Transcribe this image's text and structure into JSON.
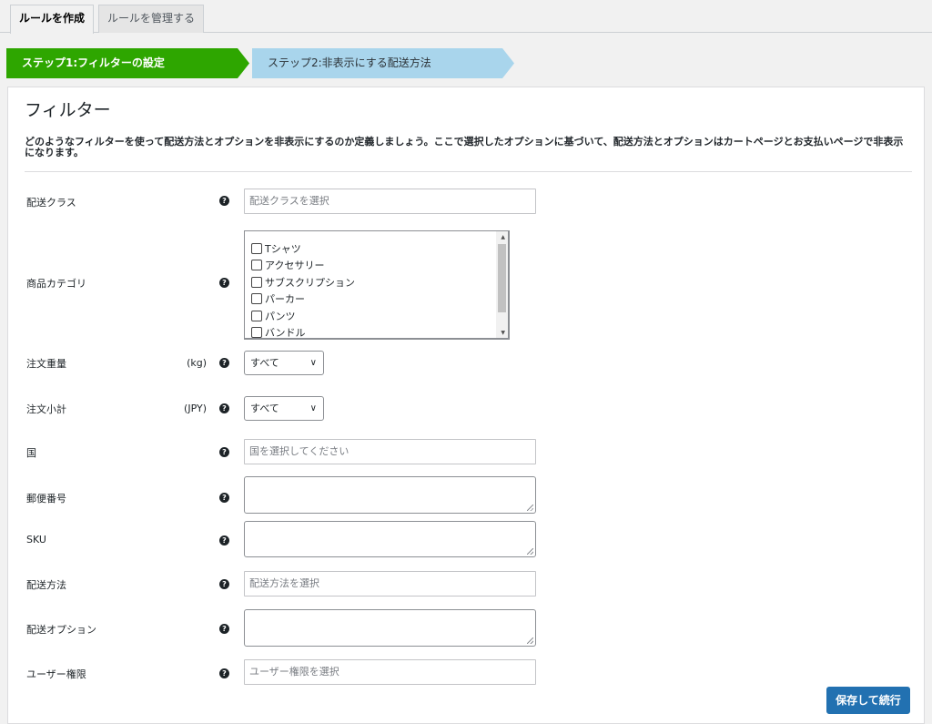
{
  "tabs": [
    {
      "label": "ルールを作成",
      "active": true
    },
    {
      "label": "ルールを管理する",
      "active": false
    }
  ],
  "steps": [
    {
      "label": "ステップ1:フィルターの設定",
      "active": true
    },
    {
      "label": "ステップ2:非表示にする配送方法",
      "active": false
    }
  ],
  "panel": {
    "title": "フィルター",
    "description": "どのようなフィルターを使って配送方法とオプションを非表示にするのか定義しましょう。ここで選択したオプションに基づいて、配送方法とオプションはカートページとお支払いページで非表示になります。"
  },
  "fields": {
    "shipping_class": {
      "label": "配送クラス",
      "placeholder": "配送クラスを選択"
    },
    "product_category": {
      "label": "商品カテゴリ",
      "options": [
        "Tシャツ",
        "アクセサリー",
        "サブスクリプション",
        "パーカー",
        "パンツ",
        "バンドル"
      ]
    },
    "order_weight": {
      "label": "注文重量",
      "unit": "(kg)",
      "value": "すべて"
    },
    "order_subtotal": {
      "label": "注文小計",
      "unit": "(JPY)",
      "value": "すべて"
    },
    "country": {
      "label": "国",
      "placeholder": "国を選択してください"
    },
    "postcode": {
      "label": "郵便番号"
    },
    "sku": {
      "label": "SKU"
    },
    "shipping_method": {
      "label": "配送方法",
      "placeholder": "配送方法を選択"
    },
    "shipping_option": {
      "label": "配送オプション"
    },
    "user_role": {
      "label": "ユーザー権限",
      "placeholder": "ユーザー権限を選択"
    }
  },
  "help_icon": "?",
  "save_button": "保存して続行",
  "colors": {
    "step_active": "#2ea600",
    "step_inactive": "#a9d5ec",
    "primary": "#2271b1"
  }
}
